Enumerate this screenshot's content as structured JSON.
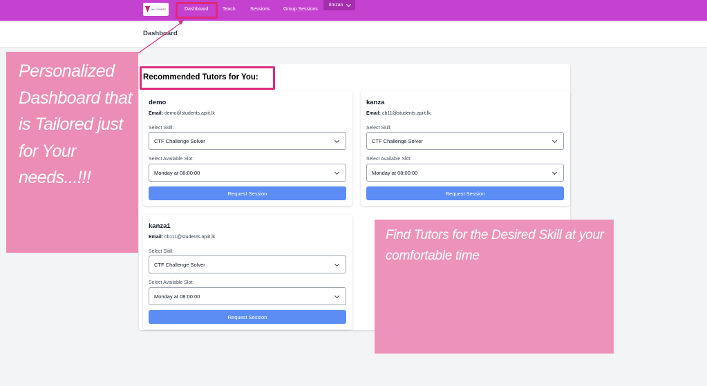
{
  "nav": {
    "logo_text": "IKI CODERS",
    "items": [
      "Dashboard",
      "Teach",
      "Sessions",
      "Group Sessions"
    ],
    "user": "rimzan"
  },
  "page": {
    "title": "Dashboard",
    "section_heading": "Recommended Tutors for You:"
  },
  "labels": {
    "email": "Email:",
    "select_skill": "Select Skill:",
    "select_slot": "Select Available Slot:",
    "request_button": "Request Session"
  },
  "tutors": [
    {
      "name": "demo",
      "email": "demo@students.apiit.lk",
      "skill": "CTF Challenge Solver",
      "slot": "Monday at 08:00:00"
    },
    {
      "name": "kanza",
      "email": "cb11@students.apiit.lk",
      "skill": "CTF Challenge Solver",
      "slot": "Monday at 08:00:00"
    },
    {
      "name": "kanza1",
      "email": "cb111@students.apiit.lk",
      "skill": "CTF Challenge Solver",
      "slot": "Monday at 08:00:00"
    }
  ],
  "annotations": {
    "left": "Personalized Dashboard that is Tailored just for Your needs...!!!",
    "right": "Find Tutors for the Desired Skill at your comfortable time"
  },
  "colors": {
    "nav_bg": "#c541cf",
    "button": "#5b8df5",
    "callout": "#ec8db6",
    "highlight": "#e0287a"
  }
}
